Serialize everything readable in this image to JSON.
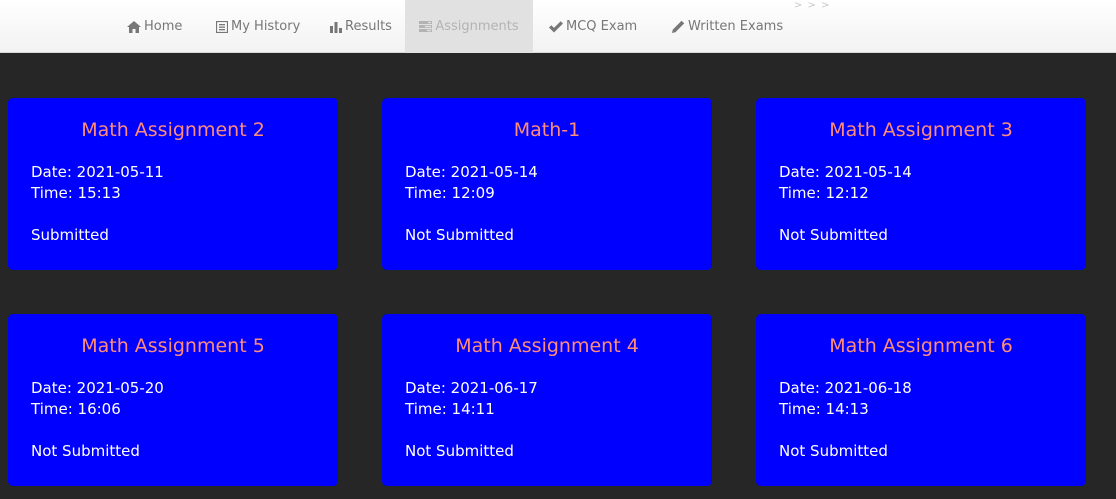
{
  "nav": {
    "items": [
      {
        "label": "Home",
        "icon": "home-icon"
      },
      {
        "label": "My History",
        "icon": "list-icon"
      },
      {
        "label": "Results",
        "icon": "bar-chart-icon"
      },
      {
        "label": "Assignments",
        "icon": "tasks-icon",
        "active": true
      },
      {
        "label": "MCQ Exam",
        "icon": "check-icon"
      },
      {
        "label": "Written Exams",
        "icon": "pencil-icon"
      }
    ],
    "more": "> > >"
  },
  "assignments": [
    {
      "title": "Math Assignment 2",
      "date": "Date: 2021-05-11",
      "time": "Time: 15:13",
      "status": "Submitted"
    },
    {
      "title": "Math-1",
      "date": "Date: 2021-05-14",
      "time": "Time: 12:09",
      "status": "Not Submitted"
    },
    {
      "title": "Math Assignment 3",
      "date": "Date: 2021-05-14",
      "time": "Time: 12:12",
      "status": "Not Submitted"
    },
    {
      "title": "Math Assignment 5",
      "date": "Date: 2021-05-20",
      "time": "Time: 16:06",
      "status": "Not Submitted"
    },
    {
      "title": "Math Assignment 4",
      "date": "Date: 2021-06-17",
      "time": "Time: 14:11",
      "status": "Not Submitted"
    },
    {
      "title": "Math Assignment 6",
      "date": "Date: 2021-06-18",
      "time": "Time: 14:13",
      "status": "Not Submitted"
    }
  ],
  "colors": {
    "background": "#262626",
    "card": "#0000ff",
    "card_title": "#ff8c7a",
    "card_text": "#ffffff",
    "nav_text": "#777777",
    "nav_active_bg": "#e1e1e1"
  }
}
